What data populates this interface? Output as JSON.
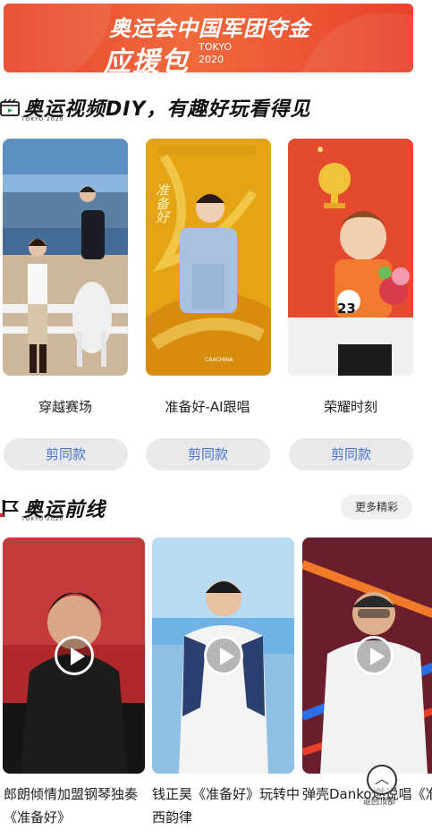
{
  "banner": {
    "line1": "奥运会中国军团夺金",
    "line2": "应援包",
    "tokyo": "TOKYO",
    "year": "2020"
  },
  "diy_section": {
    "title": "奥运视频DIY，有趣好玩看得见",
    "subtitle": "TOKYO 2020",
    "icon": "video-clip-icon",
    "cards": [
      {
        "title": "穿越赛场",
        "button": "剪同款"
      },
      {
        "title": "准备好-AI跟唱",
        "button": "剪同款",
        "overlay_text": "准备好",
        "logo_text": "CAACHINA"
      },
      {
        "title": "荣耀时刻",
        "button": "剪同款",
        "bib_number": "23"
      }
    ]
  },
  "frontline_section": {
    "title": "奥运前线",
    "subtitle": "TOKYO 2020",
    "icon": "flag-icon",
    "more_button": "更多精彩",
    "videos": [
      {
        "title": "郎朗倾情加盟钢琴独奏《准备好》"
      },
      {
        "title": "钱正昊《准备好》玩转中西韵律"
      },
      {
        "title": "弹壳Danko燃说唱《准备好》"
      }
    ]
  },
  "back_to_top": {
    "icon": "chevron-up-icon",
    "label": "返回顶部"
  },
  "colors": {
    "banner_red": "#e9442a",
    "button_bg": "#e9e9ec",
    "button_text": "#4a73c8"
  }
}
